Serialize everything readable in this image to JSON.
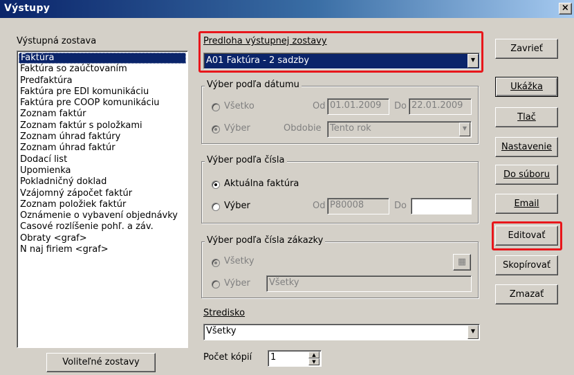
{
  "window": {
    "title": "Výstupy",
    "close_label": "×"
  },
  "left": {
    "label": "Výstupná zostava",
    "items": [
      "Faktúra",
      "Faktúra so zaúčtovaním",
      "Predfaktúra",
      "Faktúra pre EDI komunikáciu",
      "Faktúra pre COOP komunikáciu",
      "Zoznam faktúr",
      "Zoznam faktúr s položkami",
      "Zoznam úhrad faktúry",
      "Zoznam úhrad faktúr",
      "Dodací list",
      "Upomienka",
      "Pokladničný doklad",
      "Vzájomný zápočet faktúr",
      "Zoznam položiek faktúr",
      "Oznámenie o vybavení objednávky",
      "Časové rozlíšenie pohľ. a záv.",
      "Obraty <graf>",
      "N naj firiem  <graf>"
    ],
    "selected_index": 0,
    "optional_button": "Voliteľné zostavy"
  },
  "template": {
    "label": "Predloha výstupnej zostavy",
    "value": "A01 Faktúra - 2 sadzby"
  },
  "date_group": {
    "title": "Výber podľa dátumu",
    "all_label": "Všetko",
    "select_label": "Výber",
    "from_label": "Od",
    "from_value": "01.01.2009",
    "to_label": "Do",
    "to_value": "22.01.2009",
    "period_label": "Obdobie",
    "period_value": "Tento rok"
  },
  "number_group": {
    "title": "Výber podľa čísla",
    "current_label": "Aktuálna faktúra",
    "select_label": "Výber",
    "from_label": "Od",
    "from_value": "P80008",
    "to_label": "Do",
    "to_value": ""
  },
  "order_group": {
    "title": "Výber podľa čísla zákazky",
    "all_label": "Všetky",
    "select_label": "Výber",
    "select_value": "Všetky"
  },
  "center": {
    "label": "Stredisko",
    "value": "Všetky"
  },
  "copies": {
    "label": "Počet kópií",
    "value": "1"
  },
  "buttons": {
    "close": "Zavrieť",
    "preview": "Ukážka",
    "print": "Tlač",
    "settings": "Nastavenie",
    "to_file": "Do súboru",
    "email": "Email",
    "edit": "Editovať",
    "copy": "Skopírovať",
    "delete": "Zmazať"
  },
  "colors": {
    "highlight": "#e8161b",
    "selection": "#0a246a",
    "dialog_bg": "#d4d0c8"
  }
}
